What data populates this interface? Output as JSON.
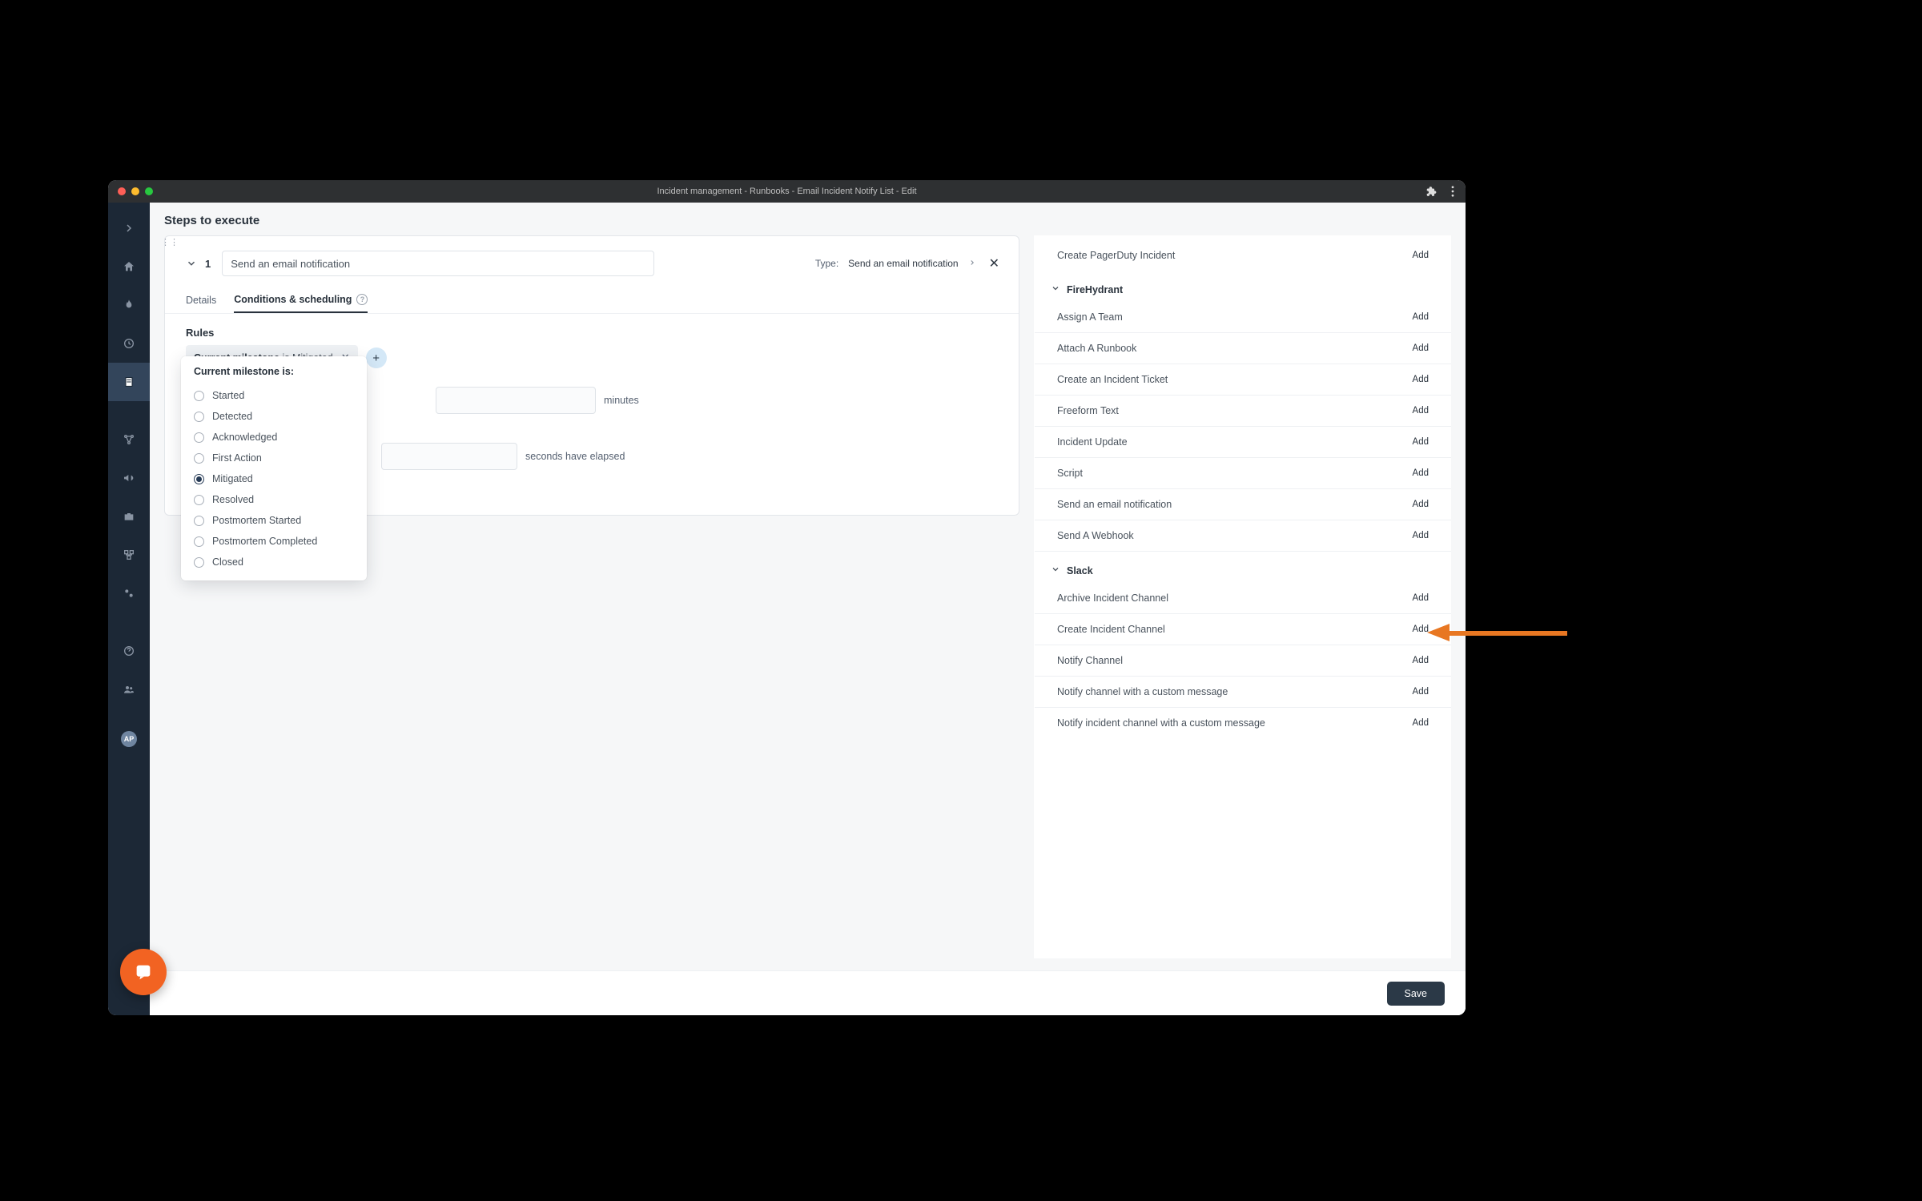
{
  "titlebar": {
    "title": "Incident management - Runbooks - Email Incident Notify List - Edit"
  },
  "sidebar": {
    "avatar_initials": "AP"
  },
  "page": {
    "header": "Steps to execute"
  },
  "step": {
    "index": "1",
    "title": "Send an email notification",
    "type_prefix": "Type: ",
    "type_value": "Send an email notification"
  },
  "tabs": {
    "details": "Details",
    "conditions": "Conditions & scheduling"
  },
  "rules": {
    "section": "Rules",
    "chip_field": "Current milestone",
    "chip_verb": "is",
    "chip_value": "Mitigated"
  },
  "fields": {
    "minutes_suffix": "minutes",
    "seconds_suffix": "seconds have elapsed"
  },
  "popover": {
    "title": "Current milestone is:",
    "options": [
      "Started",
      "Detected",
      "Acknowledged",
      "First Action",
      "Mitigated",
      "Resolved",
      "Postmortem Started",
      "Postmortem Completed",
      "Closed"
    ],
    "selected_index": 4
  },
  "actions": {
    "add_label": "Add",
    "items_top": [
      "Create PagerDuty Incident"
    ],
    "groups": [
      {
        "name": "FireHydrant",
        "items": [
          "Assign A Team",
          "Attach A Runbook",
          "Create an Incident Ticket",
          "Freeform Text",
          "Incident Update",
          "Script",
          "Send an email notification",
          "Send A Webhook"
        ]
      },
      {
        "name": "Slack",
        "items": [
          "Archive Incident Channel",
          "Create Incident Channel",
          "Notify Channel",
          "Notify channel with a custom message",
          "Notify incident channel with a custom message"
        ]
      }
    ]
  },
  "footer": {
    "save": "Save"
  }
}
